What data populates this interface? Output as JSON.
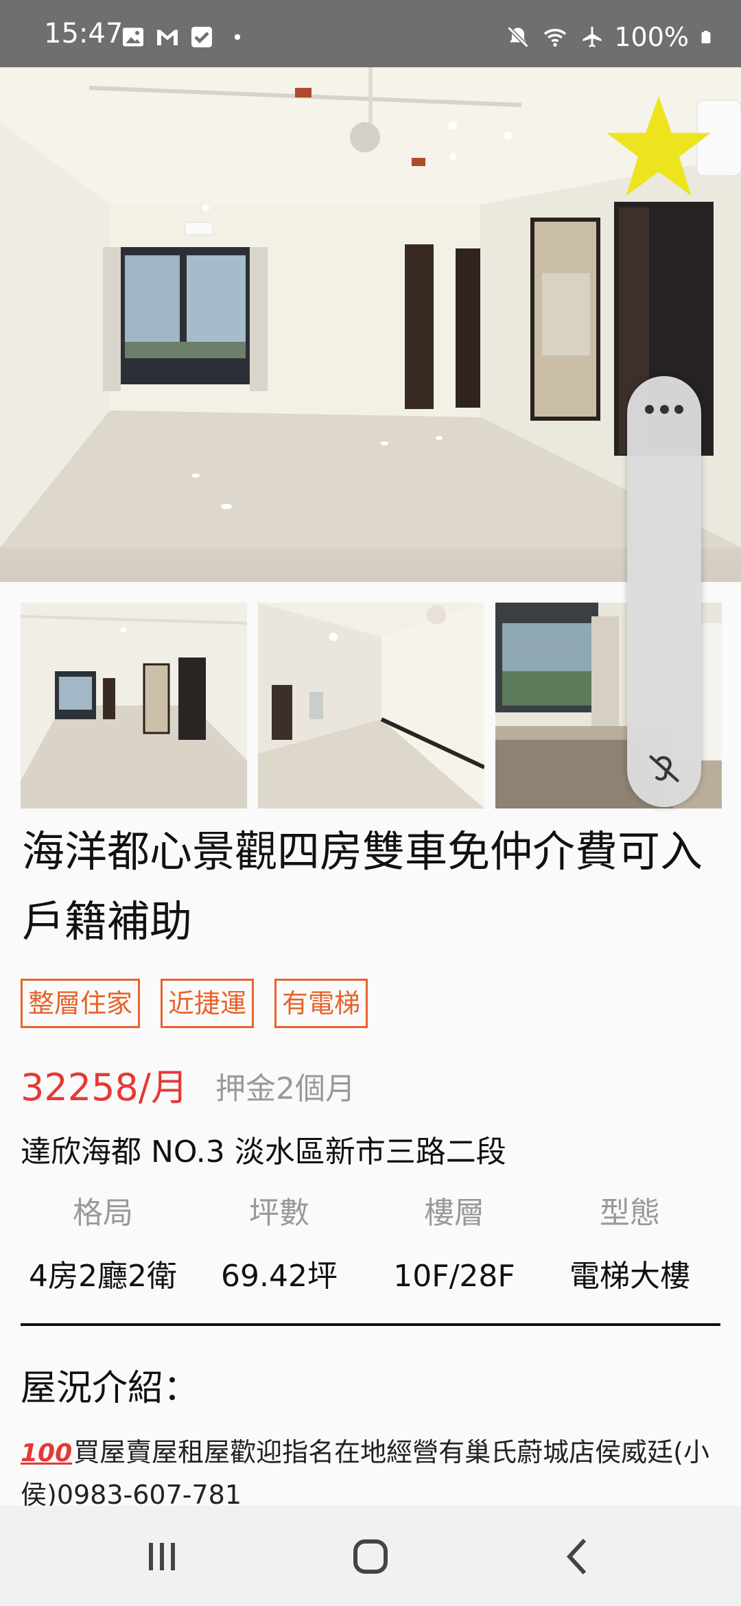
{
  "status_bar": {
    "time": "15:47",
    "left_icons": [
      "gallery-icon",
      "gmail-icon",
      "check-icon",
      "dot-icon"
    ],
    "right_icons": [
      "mute-icon",
      "wifi-icon",
      "airplane-icon",
      "battery-icon"
    ],
    "battery": "100%"
  },
  "listing": {
    "title": "海洋都心景觀四房雙車免仲介費可入戶籍補助",
    "tags": [
      "整層住家",
      "近捷運",
      "有電梯"
    ],
    "price": "32258/月",
    "deposit": "押金2個月",
    "address": "達欣海都 NO.3 淡水區新市三路二段",
    "specs": [
      {
        "label": "格局",
        "value": "4房2廳2衛"
      },
      {
        "label": "坪數",
        "value": "69.42坪"
      },
      {
        "label": "樓層",
        "value": "10F/28F"
      },
      {
        "label": "型態",
        "value": "電梯大樓"
      }
    ],
    "section_title": "屋況介紹：",
    "description_emoji": "100",
    "description": "買屋賣屋租屋歡迎指名在地經營有巢氏蔚城店侯威廷(小侯)0983-607-781"
  },
  "colors": {
    "accent": "#e53935",
    "tag": "#e8622a",
    "star": "#ede31f"
  }
}
